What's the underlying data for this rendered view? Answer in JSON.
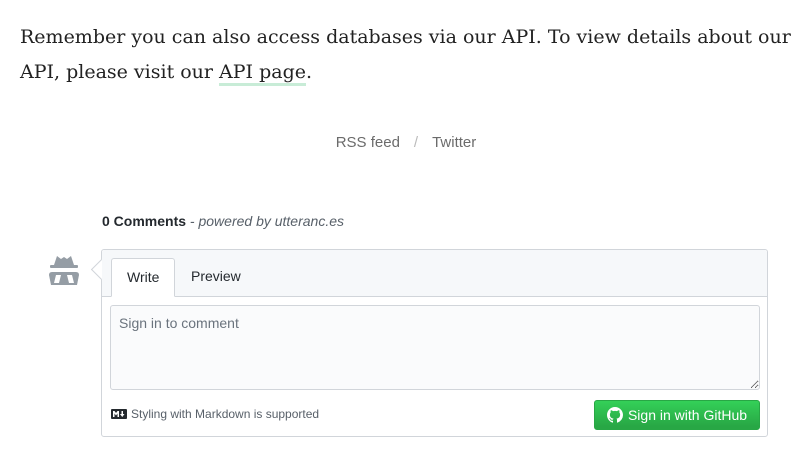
{
  "intro": {
    "text_before": "Remember you can also access databases via our API. To view details about our API, please visit our ",
    "link_text": "API page",
    "text_after": "."
  },
  "footer_links": {
    "rss": "RSS feed",
    "separator": "/",
    "twitter": "Twitter"
  },
  "comments": {
    "count_label": "0 Comments",
    "powered_by": " - powered by utteranc.es",
    "tabs": {
      "write": "Write",
      "preview": "Preview"
    },
    "textarea_placeholder": "Sign in to comment",
    "markdown_note": "Styling with Markdown is supported",
    "signin_button": "Sign in with GitHub"
  },
  "icons": {
    "avatar": "anonymous-user-icon",
    "markdown": "markdown-icon",
    "github": "github-icon"
  },
  "colors": {
    "button_green": "#2ea44f",
    "link_underline": "#c8ecd7",
    "border": "#d1d5da"
  }
}
